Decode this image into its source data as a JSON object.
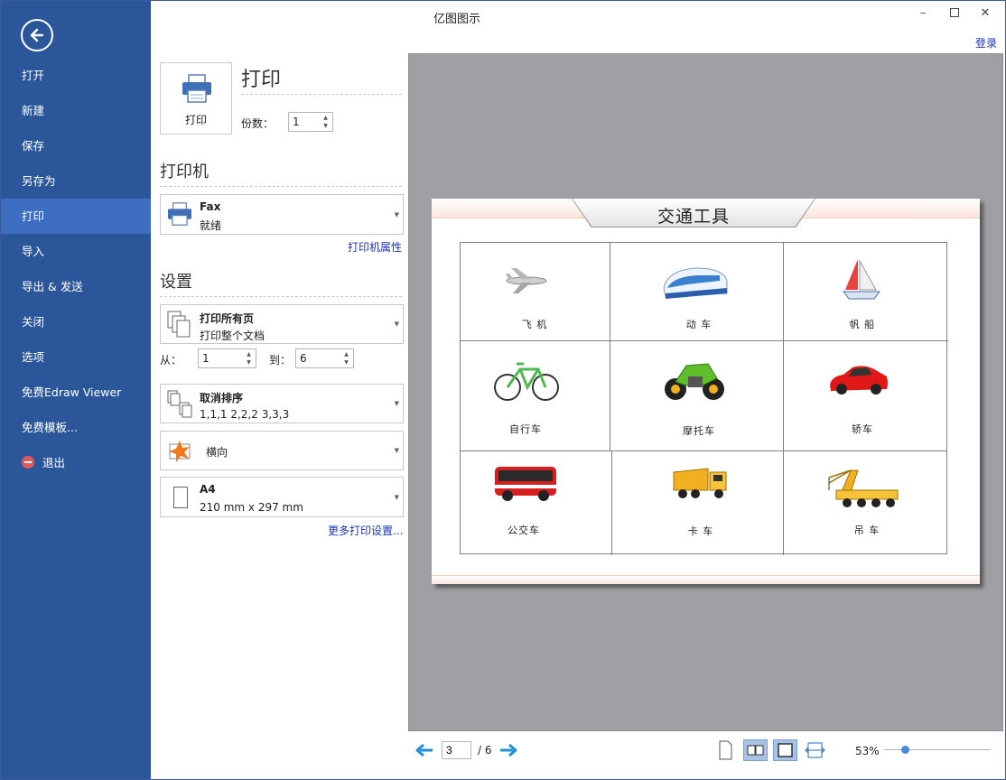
{
  "window": {
    "title": "亿图图示",
    "login": "登录"
  },
  "sidebar": {
    "items": [
      {
        "label": "打开"
      },
      {
        "label": "新建"
      },
      {
        "label": "保存"
      },
      {
        "label": "另存为"
      },
      {
        "label": "打印",
        "active": true
      },
      {
        "label": "导入"
      },
      {
        "label": "导出 & 发送"
      },
      {
        "label": "关闭"
      },
      {
        "label": "选项"
      },
      {
        "label": "免费Edraw Viewer"
      },
      {
        "label": "免费模板..."
      },
      {
        "label": "退出",
        "icon": "exit-icon"
      }
    ],
    "accent": "#2b579a",
    "active_color": "#3e6ec1"
  },
  "print": {
    "button_label": "打印",
    "heading": "打印",
    "copies_label": "份数：",
    "copies_value": "1"
  },
  "printer": {
    "section_title": "打印机",
    "name": "Fax",
    "status": "就绪",
    "properties_link": "打印机属性"
  },
  "settings": {
    "section_title": "设置",
    "range": {
      "title": "打印所有页",
      "subtitle": "打印整个文档"
    },
    "from_label": "从：",
    "from_value": "1",
    "to_label": "到：",
    "to_value": "6",
    "collate": {
      "title": "取消排序",
      "subtitle": "1,1,1   2,2,2   3,3,3"
    },
    "orientation": "横向",
    "paper": {
      "title": "A4",
      "subtitle": "210 mm x 297 mm"
    },
    "more_link": "更多打印设置..."
  },
  "preview": {
    "page_title": "交通工具",
    "cells": [
      {
        "label": "飞 机",
        "icon": "airplane-icon"
      },
      {
        "label": "动 车",
        "icon": "bullet-train-icon"
      },
      {
        "label": "帆 船",
        "icon": "sailboat-icon"
      },
      {
        "label": "自行车",
        "icon": "bicycle-icon"
      },
      {
        "label": "摩托车",
        "icon": "motorcycle-icon"
      },
      {
        "label": "轿车",
        "icon": "car-icon"
      },
      {
        "label": "公交车",
        "icon": "bus-icon"
      },
      {
        "label": "卡 车",
        "icon": "truck-icon"
      },
      {
        "label": "吊 车",
        "icon": "crane-icon"
      }
    ]
  },
  "pager": {
    "current": "3",
    "total": "/ 6",
    "zoom": "53%",
    "zoom_fraction": 0.2
  }
}
